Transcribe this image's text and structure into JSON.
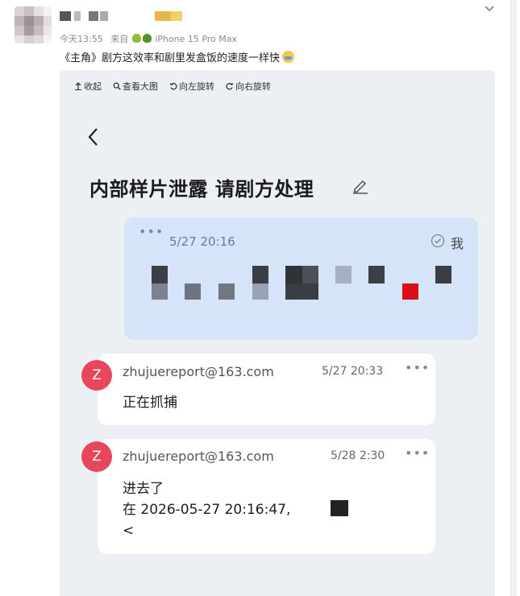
{
  "post": {
    "time": "今天13:55",
    "from_label": "来自",
    "device": "iPhone 15 Pro Max",
    "text": "《主角》剧方这效率和剧里发盒饭的速度一样快"
  },
  "viewer": {
    "toolbar": [
      {
        "icon": "collapse-icon",
        "label": "收起"
      },
      {
        "icon": "zoom-icon",
        "label": "查看大图"
      },
      {
        "icon": "rotate-left-icon",
        "label": "向左旋转"
      },
      {
        "icon": "rotate-right-icon",
        "label": "向右旋转"
      }
    ]
  },
  "mail": {
    "title": "内部样片泄露 请剧方处理",
    "my_message": {
      "menu": "•••",
      "time": "5/27 20:16",
      "me_label": "我"
    },
    "replies": [
      {
        "avatar_letter": "Z",
        "sender": "zhujuereport@163.com",
        "time": "5/27 20:33",
        "menu": "•••",
        "body": [
          "正在抓捕"
        ]
      },
      {
        "avatar_letter": "Z",
        "sender": "zhujuereport@163.com",
        "time": "5/28 2:30",
        "menu": "•••",
        "body": [
          "进去了",
          "在 2026-05-27 20:16:47,",
          "<"
        ]
      }
    ]
  },
  "colors": {
    "avatar_red": "#e8475b",
    "bubble_blue": "#d6e4fa",
    "viewer_bg": "#eceff3"
  }
}
